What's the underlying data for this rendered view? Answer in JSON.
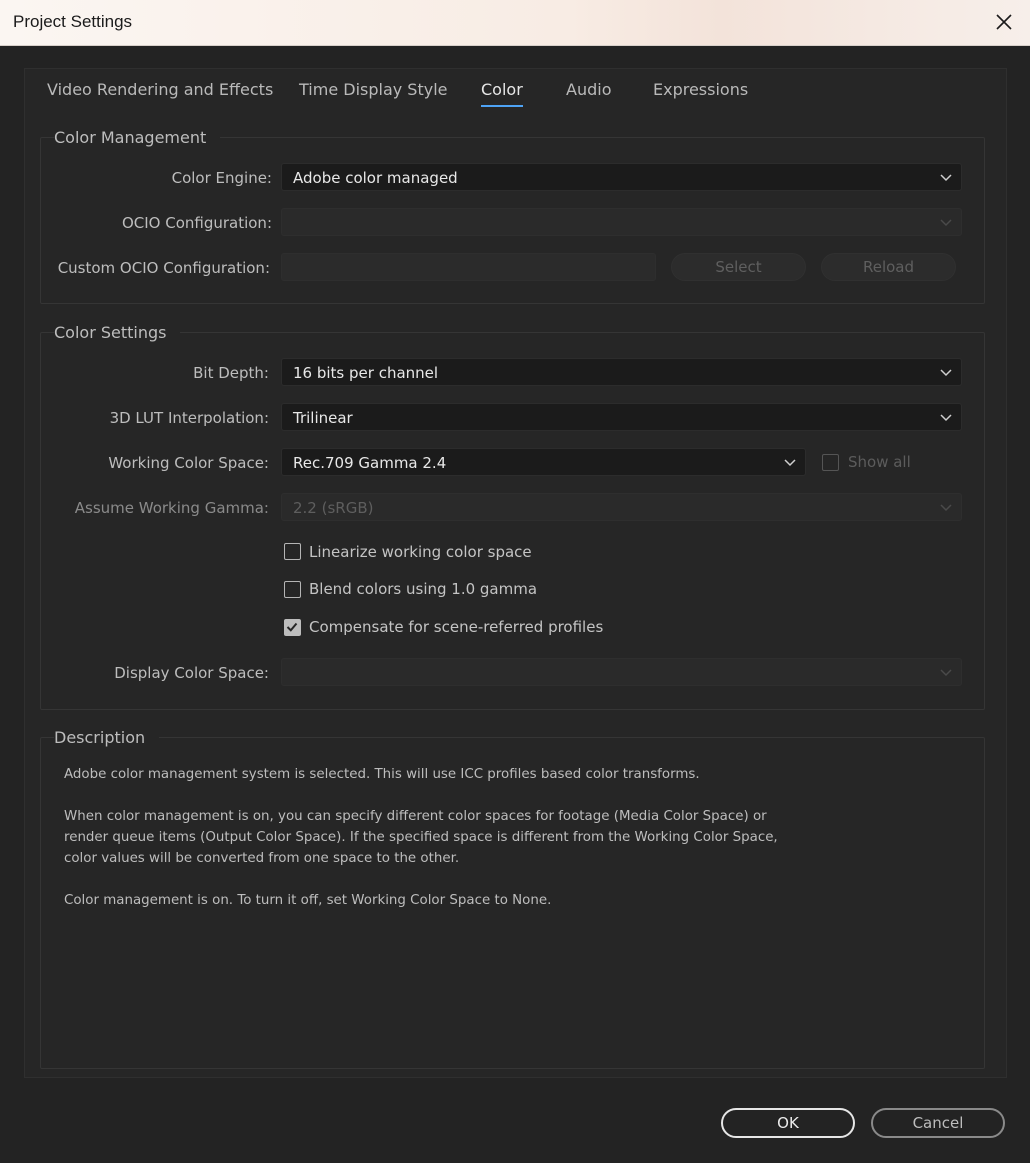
{
  "window": {
    "title": "Project Settings"
  },
  "tabs": [
    {
      "label": "Video Rendering and Effects",
      "active": false
    },
    {
      "label": "Time Display Style",
      "active": false
    },
    {
      "label": "Color",
      "active": true
    },
    {
      "label": "Audio",
      "active": false
    },
    {
      "label": "Expressions",
      "active": false
    }
  ],
  "color_management": {
    "title": "Color Management",
    "color_engine": {
      "label": "Color Engine:",
      "value": "Adobe color managed"
    },
    "ocio_configuration": {
      "label": "OCIO Configuration:",
      "value": ""
    },
    "custom_ocio": {
      "label": "Custom OCIO Configuration:",
      "value": "",
      "select_label": "Select",
      "reload_label": "Reload"
    }
  },
  "color_settings": {
    "title": "Color Settings",
    "bit_depth": {
      "label": "Bit Depth:",
      "value": "16 bits per channel"
    },
    "lut_interpolation": {
      "label": "3D LUT Interpolation:",
      "value": "Trilinear"
    },
    "working_color_space": {
      "label": "Working Color Space:",
      "value": "Rec.709 Gamma 2.4",
      "show_all_label": "Show all",
      "show_all_checked": false
    },
    "assume_working_gamma": {
      "label": "Assume Working Gamma:",
      "value": "2.2 (sRGB)"
    },
    "linearize": {
      "label": "Linearize working color space",
      "checked": false
    },
    "blend": {
      "label": "Blend colors using 1.0 gamma",
      "checked": false
    },
    "compensate": {
      "label": "Compensate for scene-referred profiles",
      "checked": true
    },
    "display_color_space": {
      "label": "Display Color Space:",
      "value": ""
    }
  },
  "description": {
    "title": "Description",
    "paragraphs": [
      "Adobe color management system is selected. This will use ICC profiles based color transforms.",
      "When color management is on, you can specify different color spaces for footage (Media Color Space) or\nrender queue items (Output Color Space). If the specified space is different from the Working Color Space,\ncolor values will be converted from one space to the other.",
      "Color management is on. To turn it off, set Working Color Space to None."
    ]
  },
  "footer": {
    "ok_label": "OK",
    "cancel_label": "Cancel"
  },
  "colors": {
    "accent": "#4ea3f5",
    "background": "#232323",
    "titlebar": "#f8ece4"
  }
}
